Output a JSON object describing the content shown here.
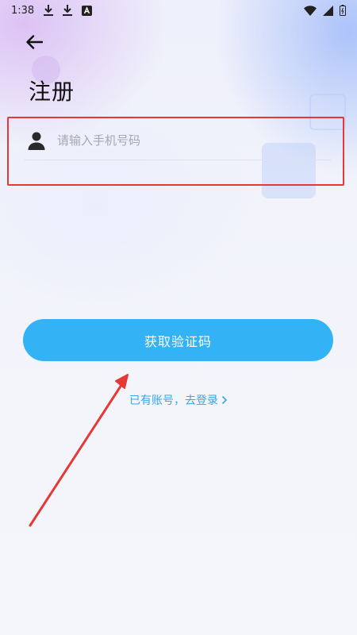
{
  "status_bar": {
    "time": "1:38",
    "icons_left": [
      "download-icon",
      "download-icon",
      "app-store-icon"
    ],
    "icons_right": [
      "wifi-icon",
      "signal-icon",
      "battery-icon"
    ]
  },
  "header": {
    "back_icon": "arrow-left-icon",
    "title": "注册"
  },
  "form": {
    "phone_field": {
      "icon": "user-icon",
      "placeholder": "请输入手机号码",
      "value": ""
    }
  },
  "actions": {
    "get_code_label": "获取验证码",
    "login_link_label": "已有账号，去登录"
  },
  "colors": {
    "accent": "#33b2f6",
    "link": "#36a6e8",
    "annotation_red": "#e53935"
  }
}
